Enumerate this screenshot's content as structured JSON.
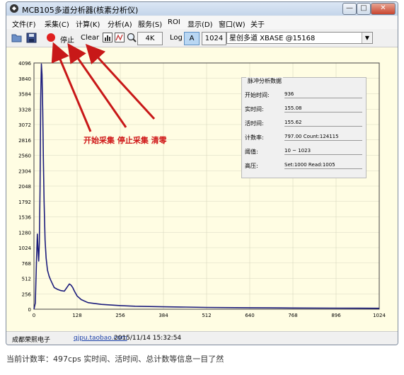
{
  "window": {
    "title": "MCB105多道分析器(核素分析仪)",
    "min": "—",
    "max": "□",
    "close": "✕"
  },
  "menu": [
    "文件(F)",
    "采集(C)",
    "计算(K)",
    "分析(A)",
    "服务(S)",
    "ROI",
    "显示(D)",
    "窗口(W)",
    "关于"
  ],
  "toolbar": {
    "open_icon": "folder-open-icon",
    "save_icon": "save-icon",
    "record_icon": "record-icon",
    "record_color": "#e02020",
    "stop_label": "停止",
    "clear_label": "Clear",
    "bar_icon": "bar-chart-icon",
    "fit_icon": "fit-icon",
    "zoom_icon": "zoom-icon",
    "range_label": "4K",
    "log_label": "Log",
    "auto_label": "A",
    "channels_label": "1024",
    "device": "星创多道 XBASE @15168"
  },
  "chart_data": {
    "type": "line",
    "color": "#1c1c7c",
    "xlim": [
      0,
      1024
    ],
    "ylim": [
      0,
      4096
    ],
    "x_ticks": [
      0,
      128,
      256,
      384,
      512,
      640,
      768,
      896,
      1024
    ],
    "y_ticks": [
      0,
      256,
      512,
      768,
      1024,
      1280,
      1536,
      1792,
      2048,
      2304,
      2560,
      2816,
      3072,
      3328,
      3584,
      3840,
      4096
    ],
    "grid": true,
    "x": [
      0,
      4,
      8,
      10,
      12,
      14,
      16,
      18,
      20,
      22,
      24,
      26,
      28,
      30,
      33,
      36,
      40,
      45,
      50,
      55,
      60,
      70,
      80,
      90,
      100,
      105,
      110,
      115,
      120,
      128,
      140,
      160,
      200,
      256,
      300,
      384,
      450,
      512,
      640,
      768,
      896,
      1024
    ],
    "y": [
      0,
      100,
      900,
      1250,
      1000,
      800,
      1100,
      2000,
      3500,
      4080,
      3900,
      3300,
      2500,
      1800,
      1150,
      850,
      650,
      550,
      480,
      420,
      360,
      330,
      310,
      300,
      380,
      420,
      400,
      360,
      300,
      220,
      160,
      110,
      80,
      60,
      50,
      40,
      35,
      30,
      25,
      20,
      18,
      15
    ]
  },
  "panel": {
    "title": "脉冲分析数据",
    "rows": [
      {
        "label": "开始时间:",
        "value": "936"
      },
      {
        "label": "实时间:",
        "value": "155.08"
      },
      {
        "label": "活时间:",
        "value": "155.62"
      },
      {
        "label": "计数率:",
        "value": "797.00 Count:124115"
      },
      {
        "label": "阈值:",
        "value": "10 ~ 1023"
      },
      {
        "label": "高压:",
        "value": "Set:1000 Read:1005"
      }
    ]
  },
  "annotation": {
    "text": "开始采集 停止采集   清零",
    "color": "#d01818"
  },
  "status": {
    "company": "成都荣熙电子",
    "link": "qjpu.taobao.com",
    "datetime": "2015/11/14 15:32:54"
  },
  "caption": "当前计数率：497cps    实时间、活时间、总计数等信息一目了然"
}
